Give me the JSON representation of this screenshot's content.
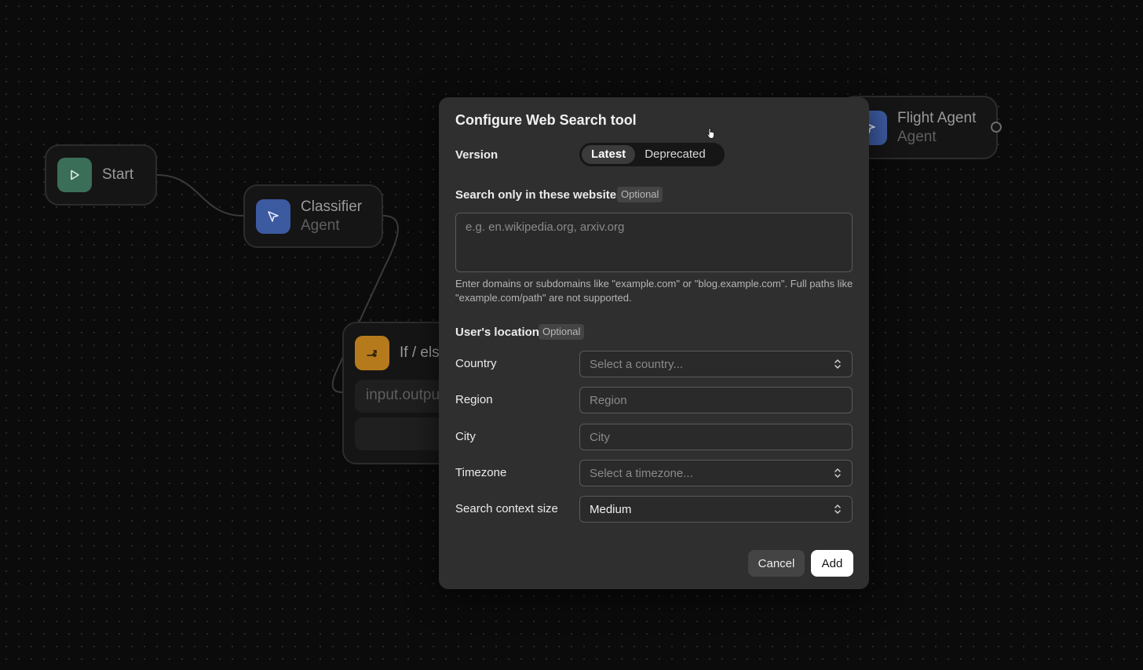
{
  "canvas": {
    "nodes": {
      "start": {
        "title": "Start",
        "icon": "play-icon",
        "color": "#3b6e58"
      },
      "classifier": {
        "title": "Classifier",
        "subtitle": "Agent",
        "icon": "cursor-arrow-icon",
        "color": "#3c5aa0"
      },
      "flight": {
        "title": "Flight Agent",
        "subtitle": "Agent",
        "icon": "cursor-arrow-icon",
        "color": "#3c5aa0"
      },
      "ifelse": {
        "title": "If / else",
        "icon": "branch-icon",
        "color": "#b47a1c",
        "condition": "input.output"
      }
    }
  },
  "modal": {
    "title": "Configure Web Search tool",
    "version": {
      "label": "Version",
      "options": [
        "Latest",
        "Deprecated"
      ],
      "selected": "Latest"
    },
    "websites": {
      "label": "Search only in these websites",
      "badge": "Optional",
      "placeholder": "e.g. en.wikipedia.org, arxiv.org",
      "help": "Enter domains or subdomains like \"example.com\" or \"blog.example.com\". Full paths like \"example.com/path\" are not supported."
    },
    "location": {
      "label": "User's location",
      "badge": "Optional",
      "country": {
        "label": "Country",
        "placeholder": "Select a country..."
      },
      "region": {
        "label": "Region",
        "placeholder": "Region"
      },
      "city": {
        "label": "City",
        "placeholder": "City"
      },
      "timezone": {
        "label": "Timezone",
        "placeholder": "Select a timezone..."
      }
    },
    "context_size": {
      "label": "Search context size",
      "value": "Medium"
    },
    "buttons": {
      "cancel": "Cancel",
      "add": "Add"
    }
  }
}
